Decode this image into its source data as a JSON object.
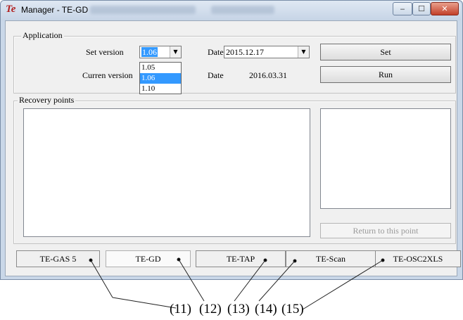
{
  "window": {
    "title": "Manager - TE-GD",
    "logo_text": "Te"
  },
  "application_group": {
    "title": "Application",
    "set_version_label": "Set version",
    "set_version_value": "1.06",
    "current_version_label": "Curren version",
    "date_label": "Date",
    "set_date_value": "2015.12.17",
    "current_date_value": "2016.03.31",
    "set_button": "Set",
    "run_button": "Run",
    "version_options": [
      "1.05",
      "1.06",
      "1.10"
    ],
    "selected_option_index": 1
  },
  "recovery_group": {
    "title": "Recovery points",
    "return_button": "Return to this point"
  },
  "tabs": [
    {
      "label": "TE-GAS 5"
    },
    {
      "label": "TE-GD"
    },
    {
      "label": "TE-TAP"
    },
    {
      "label": "TE-Scan"
    },
    {
      "label": "TE-OSC2XLS"
    }
  ],
  "active_tab": "TE-GD",
  "callouts": [
    "(11)",
    "(12)",
    "(13)",
    "(14)",
    "(15)"
  ],
  "colors": {
    "selection": "#3399ff",
    "close_button": "#c2402a",
    "logo": "#b22222"
  }
}
